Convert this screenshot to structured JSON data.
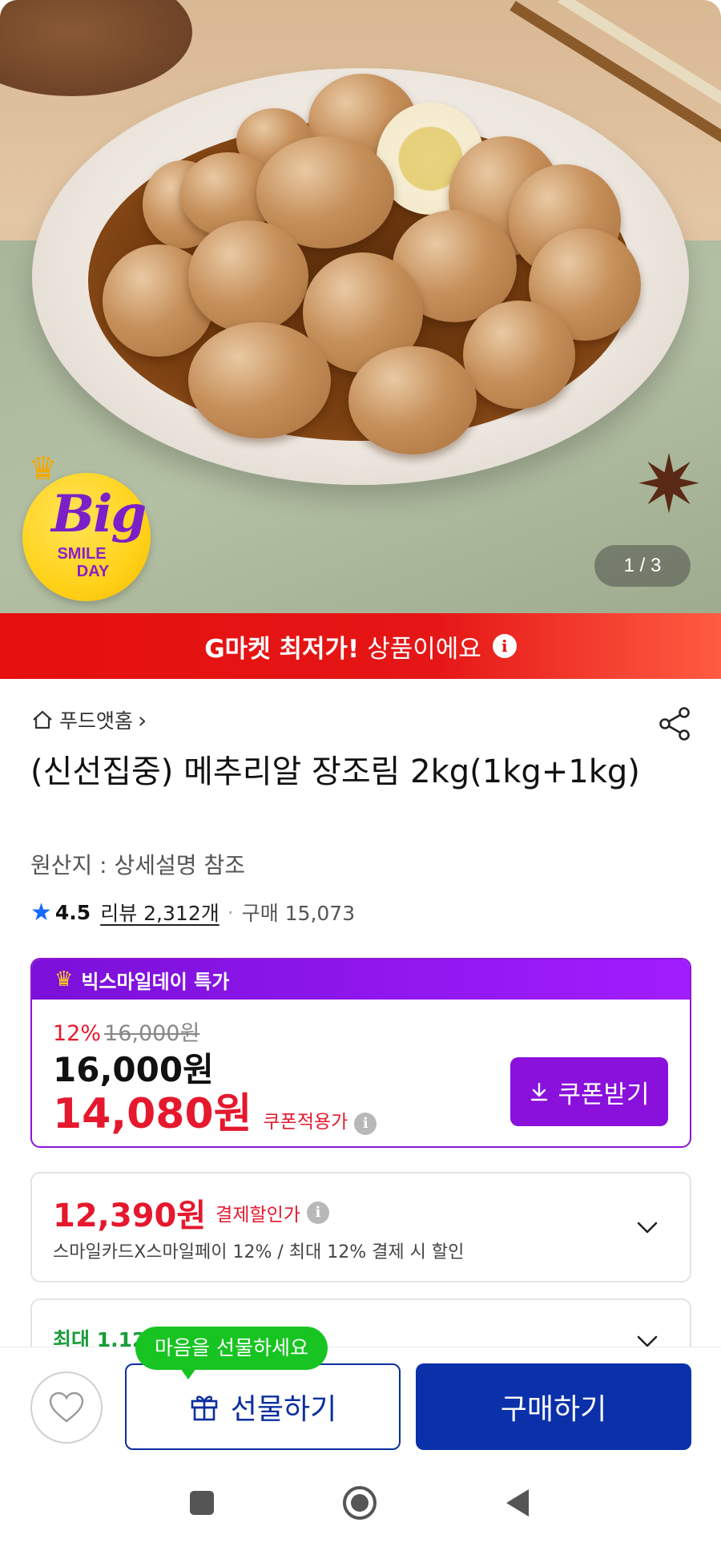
{
  "hero": {
    "image_alt": "간장 메추리알 장조림",
    "badge": {
      "big": "Big",
      "smile": "SMILE",
      "day": "DAY"
    },
    "counter": "1 / 3"
  },
  "promo": {
    "strong": "G마켓 최저가!",
    "rest": "상품이에요",
    "info_icon": "i"
  },
  "breadcrumb": {
    "label": "푸드앳홈",
    "chevron": "›"
  },
  "product": {
    "title": "(신선집중) 메추리알 장조림 2kg(1kg+1kg)",
    "origin": "원산지 : 상세설명 참조",
    "rating": "4.5",
    "reviews": "리뷰 2,312개",
    "dot": "·",
    "purchases": "구매 15,073"
  },
  "deal": {
    "header": "빅스마일데이 특가",
    "discount_pct": "12%",
    "original_price": "16,000원",
    "price": "16,000원",
    "coupon_price": "14,080원",
    "coupon_label": "쿠폰적용가",
    "coupon_button": "쿠폰받기",
    "info_icon": "i"
  },
  "payment": {
    "price": "12,390원",
    "label": "결제할인가",
    "desc": "스마일카드X스마일페이 12% / 최대 12% 결제 시 할인",
    "info_icon": "i"
  },
  "payment2": {
    "text": "최대 1,12"
  },
  "actions": {
    "tooltip": "마음을 선물하세요",
    "gift": "선물하기",
    "buy": "구매하기"
  },
  "colors": {
    "promo_red": "#e5100f",
    "deal_purple": "#8a10dc",
    "price_red": "#e5182d",
    "buy_blue": "#0a31aa",
    "tooltip_green": "#18c421",
    "rating_star": "#1769ff"
  }
}
